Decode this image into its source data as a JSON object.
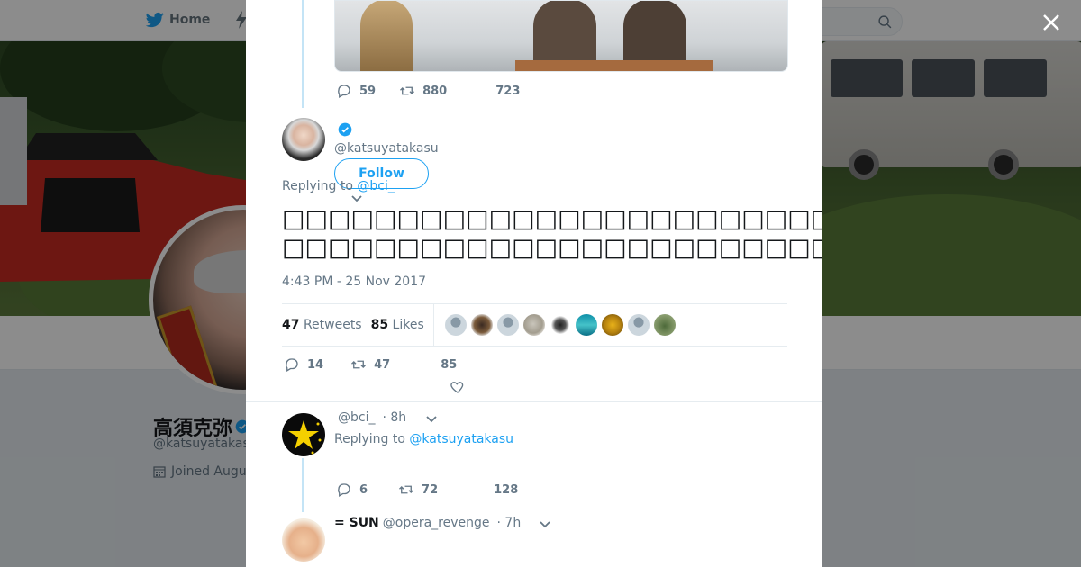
{
  "nav": {
    "home_label": "Home"
  },
  "profile": {
    "name": "高須克弥",
    "handle": "@katsuyatakasu",
    "joined": "Joined Augu"
  },
  "prev_tweet_actions": {
    "replies": "59",
    "retweets": "880",
    "likes": "723"
  },
  "main_tweet": {
    "handle": "@katsuyatakasu",
    "follow_label": "Follow",
    "replying_prefix": "Replying to",
    "replying_to": "@bci_",
    "text_line1": "□□□□□□□□□□□□□□□□□□□□□□□□□□□□□□□□□□□□□□□□□□□□💢😠💢□□□□□□□□□□□□□□□□□□□□□□□□□□□",
    "text_line2": "□□□□□□□□□□□□□□□□□□□□□□□□□□□□□□□□□□□□□□□□□□□□□□□□□□□□□□□□□□□□□□□□□□□□□□□□□□□□□□□□□□□",
    "time": "4:43 PM - 25 Nov 2017",
    "retweets_count": "47",
    "retweets_label": "Retweets",
    "likes_count": "85",
    "likes_label": "Likes",
    "actions": {
      "replies": "14",
      "retweets": "47",
      "likes": "85"
    }
  },
  "reply1": {
    "handle": "@bci_",
    "time": "· 8h",
    "replying_prefix": "Replying to",
    "replying_to": "@katsuyatakasu",
    "actions": {
      "replies": "6",
      "retweets": "72",
      "likes": "128"
    }
  },
  "reply2": {
    "name": "= SUN",
    "handle": "@opera_revenge",
    "time": "· 7h"
  },
  "colors": {
    "accent": "#1da1f2",
    "muted": "#657786",
    "text": "#14171a",
    "thread": "#c4e4f6"
  }
}
